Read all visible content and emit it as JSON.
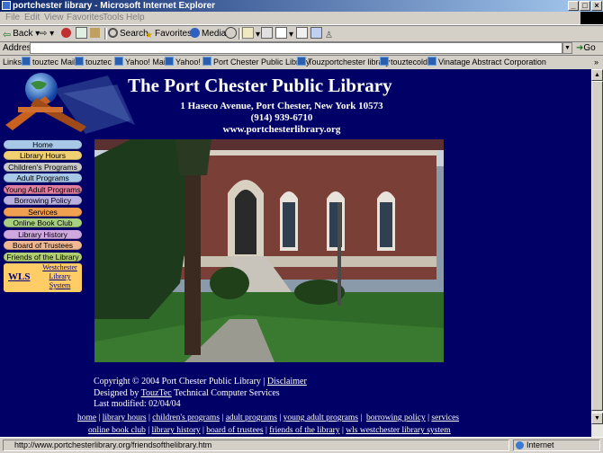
{
  "window": {
    "title": "portchester library - Microsoft Internet Explorer"
  },
  "menu": [
    "File",
    "Edit",
    "View",
    "Favorites",
    "Tools",
    "Help"
  ],
  "toolbar": {
    "back": "Back",
    "search": "Search",
    "favorites": "Favorites",
    "media": "Media"
  },
  "address": {
    "label": "Address",
    "value": "",
    "go": "Go"
  },
  "links": {
    "label": "Links",
    "items": [
      "touztec Mail",
      "touztec",
      "Yahoo! Mail",
      "Yahoo!",
      "Port Chester Public Library",
      "Touzportchester library",
      "touztecold",
      "Vinatage Abstract Corporation"
    ]
  },
  "page": {
    "title": "The Port Chester Public Library",
    "address": "1 Haseco Avenue, Port Chester, New York 10573",
    "phone": "(914) 939-6710",
    "website": "www.portchesterlibrary.org",
    "nav": [
      "Home",
      "Library Hours",
      "Children's Programs",
      "Adult Programs",
      "Young Adult Programs",
      "Borrowing Policy",
      "Services",
      "Online Book Club",
      "Library History",
      "Board of Trustees",
      "Friends of the Library"
    ],
    "nav_colors": [
      "#a8c8e8",
      "#f0d070",
      "#c8c8c8",
      "#a8c8e8",
      "#e080a0",
      "#b8b0e0",
      "#f0a050",
      "#a8d080",
      "#d0a8e0",
      "#f0b890",
      "#b0d070"
    ],
    "wls": {
      "abbr": "WLS",
      "l1": "Westchester",
      "l2": "Library",
      "l3": "System"
    },
    "footer": {
      "copyright": "Copyright © 2004 Port Chester Public Library |",
      "disclaimer": "Disclaimer",
      "designed_by": "Designed by",
      "designer": "TouzTec",
      "designer_rest": "Technical Computer Services",
      "modified": "Last modified: 02/04/04"
    },
    "bottom_nav_1": [
      "home",
      "library hours",
      "children's programs",
      "adult programs",
      "young adult programs",
      "borrowing policy",
      "services"
    ],
    "bottom_nav_2": [
      "online book club",
      "library history",
      "board of trustees",
      "friends of the library",
      "wls westchester library system"
    ]
  },
  "status": {
    "url": "http://www.portchesterlibrary.org/friendsofthelibrary.htm",
    "zone": "Internet"
  }
}
